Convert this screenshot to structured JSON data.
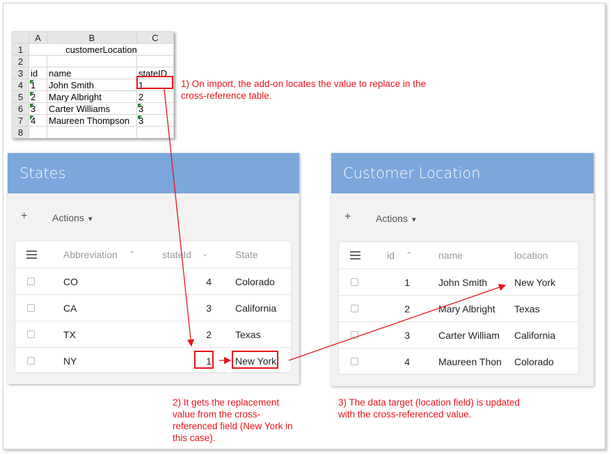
{
  "spreadsheet": {
    "col_headers": [
      "A",
      "B",
      "C"
    ],
    "row_numbers": [
      "1",
      "2",
      "3",
      "4",
      "5",
      "6",
      "7",
      "8"
    ],
    "title": "customerLocation",
    "headers": [
      "id",
      "name",
      "stateID"
    ],
    "rows": [
      [
        "1",
        "John Smith",
        "1"
      ],
      [
        "2",
        "Mary Albright",
        "2"
      ],
      [
        "3",
        "Carter Williams",
        "3"
      ],
      [
        "4",
        "Maureen Thompson",
        "3"
      ]
    ]
  },
  "annotations": {
    "step1": "1) On import, the add-on locates the value to replace in the cross-reference table.",
    "step2": "2) It gets the replacement value from the cross-referenced field (New York in this case).",
    "step3": "3) The data target (location field) is updated with the cross-referenced value."
  },
  "states_panel": {
    "title": "States",
    "add_label": "+",
    "actions_label": "Actions",
    "columns": [
      "Abbreviation",
      "stateId",
      "State"
    ],
    "rows": [
      [
        "CO",
        "4",
        "Colorado"
      ],
      [
        "CA",
        "3",
        "California"
      ],
      [
        "TX",
        "2",
        "Texas"
      ],
      [
        "NY",
        "1",
        "New York"
      ]
    ]
  },
  "customer_panel": {
    "title": "Customer Location",
    "add_label": "+",
    "actions_label": "Actions",
    "columns": [
      "id",
      "name",
      "location"
    ],
    "rows": [
      [
        "1",
        "John Smith",
        "New York"
      ],
      [
        "2",
        "Mary Albright",
        "Texas"
      ],
      [
        "3",
        "Carter William",
        "California"
      ],
      [
        "4",
        "Maureen Thon",
        "Colorado"
      ]
    ]
  },
  "colors": {
    "header_blue": "#7ba7dc",
    "annotation_red": "#e8141b"
  }
}
